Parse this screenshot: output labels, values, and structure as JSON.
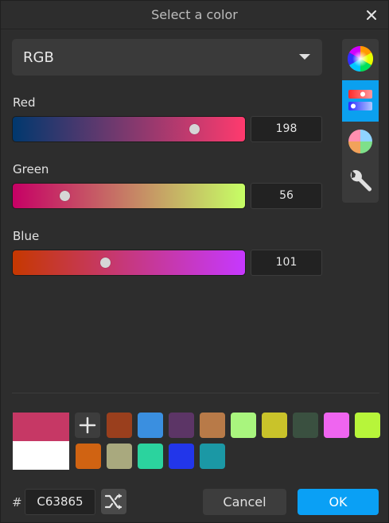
{
  "dialog": {
    "title": "Select a color"
  },
  "mode": {
    "selected": "RGB"
  },
  "side_tools": [
    {
      "name": "color-wheel-tool",
      "active": false
    },
    {
      "name": "sliders-tool",
      "active": true
    },
    {
      "name": "palette-wheel-tool",
      "active": false
    },
    {
      "name": "settings-wrench-tool",
      "active": false
    }
  ],
  "channels": {
    "red": {
      "label": "Red",
      "value": "198",
      "fraction": 0.776
    },
    "green": {
      "label": "Green",
      "value": "56",
      "fraction": 0.22
    },
    "blue": {
      "label": "Blue",
      "value": "101",
      "fraction": 0.396
    }
  },
  "preview": {
    "new_color": "#c63865",
    "old_color": "#ffffff"
  },
  "swatches": [
    "#9a3f1d",
    "#3a8fe0",
    "#5c3566",
    "#b87a48",
    "#a9f57e",
    "#c9c32a",
    "#3a5040",
    "#ef65f0",
    "#b7f53a",
    "#d06312",
    "#a9a97e",
    "#2bd39e",
    "#2236ea",
    "#1b98a5"
  ],
  "hex": {
    "prefix": "#",
    "value": "C63865"
  },
  "buttons": {
    "cancel": "Cancel",
    "ok": "OK"
  },
  "colors": {
    "accent": "#0aa0f5",
    "background": "#2d2d2d"
  }
}
